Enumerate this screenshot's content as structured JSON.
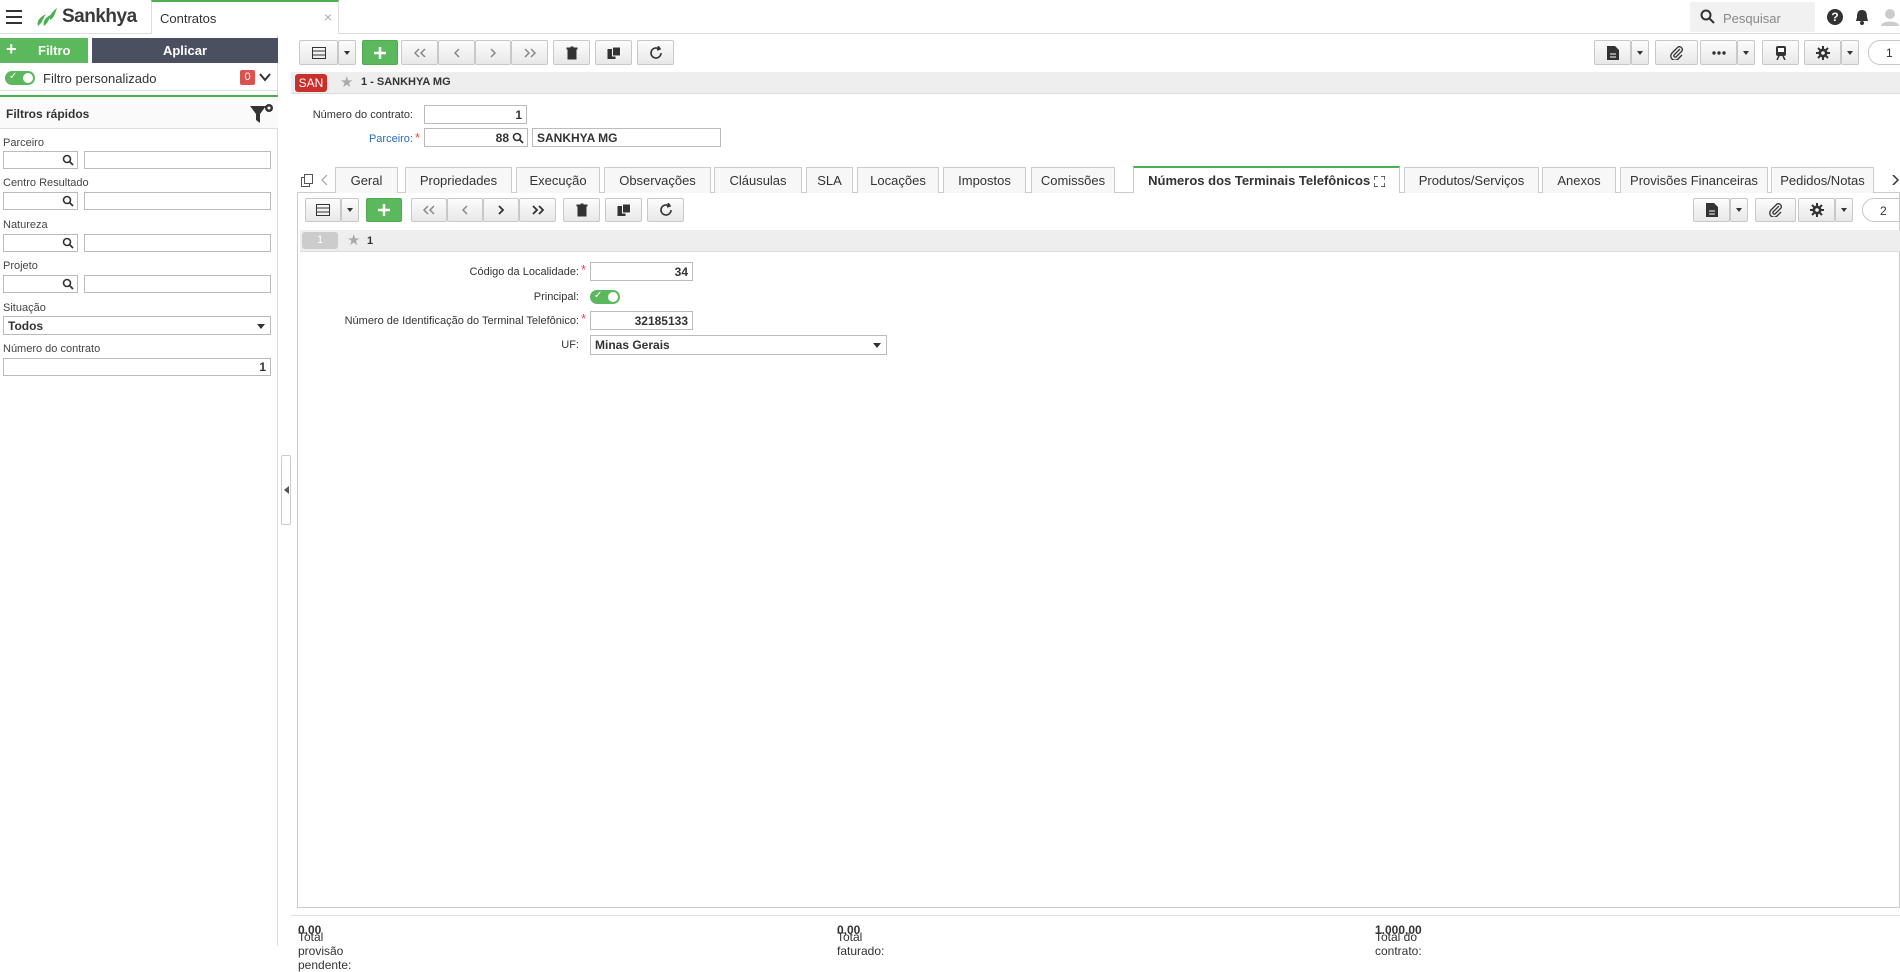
{
  "app": {
    "brand": "Sankhya",
    "tab_title": "Contratos",
    "close": "×",
    "search_placeholder": "Pesquisar"
  },
  "left": {
    "filtro_label": "Filtro",
    "aplicar_label": "Aplicar",
    "filtro_personalizado": "Filtro personalizado",
    "badge": "0",
    "filtros_rapidos": "Filtros rápidos",
    "fields": [
      {
        "label": "Parceiro"
      },
      {
        "label": "Centro Resultado"
      },
      {
        "label": "Natureza"
      },
      {
        "label": "Projeto"
      }
    ],
    "situacao_label": "Situação",
    "situacao_value": "Todos",
    "numero_label": "Número do contrato",
    "numero_value": "1"
  },
  "toolbar": {
    "page": "1"
  },
  "header": {
    "badge": "SAN",
    "title": "1 - SANKHYA MG"
  },
  "form": {
    "numero_label": "Número do contrato:",
    "numero_value": "1",
    "parceiro_label": "Parceiro:",
    "parceiro_code": "88",
    "parceiro_name": "SANKHYA MG"
  },
  "tabs": [
    "Geral",
    "Propriedades",
    "Execução",
    "Observações",
    "Cláusulas",
    "SLA",
    "Locações",
    "Impostos",
    "Comissões",
    "Números dos Terminais Telefônicos",
    "Produtos/Serviços",
    "Anexos",
    "Provisões Financeiras",
    "Pedidos/Notas"
  ],
  "subtoolbar": {
    "page": "2"
  },
  "detail": {
    "pill": "1",
    "title": "1",
    "cod_label": "Código da Localidade:",
    "cod_value": "34",
    "principal_label": "Principal:",
    "num_label": "Número de Identificação do Terminal Telefônico:",
    "num_value": "32185133",
    "uf_label": "UF:",
    "uf_value": "Minas Gerais"
  },
  "footer": {
    "pendente_label": "Total provisão pendente:",
    "pendente_value": "0,00",
    "faturado_label": "Total faturado:",
    "faturado_value": "0,00",
    "contrato_label": "Total do contrato:",
    "contrato_value": "1.000,00"
  },
  "colors": {
    "accent": "#4caf50",
    "button_green": "#5cb85c",
    "dark_button": "#4a5060",
    "badge_red": "#d9534f",
    "link_blue": "#2a6ebb"
  }
}
